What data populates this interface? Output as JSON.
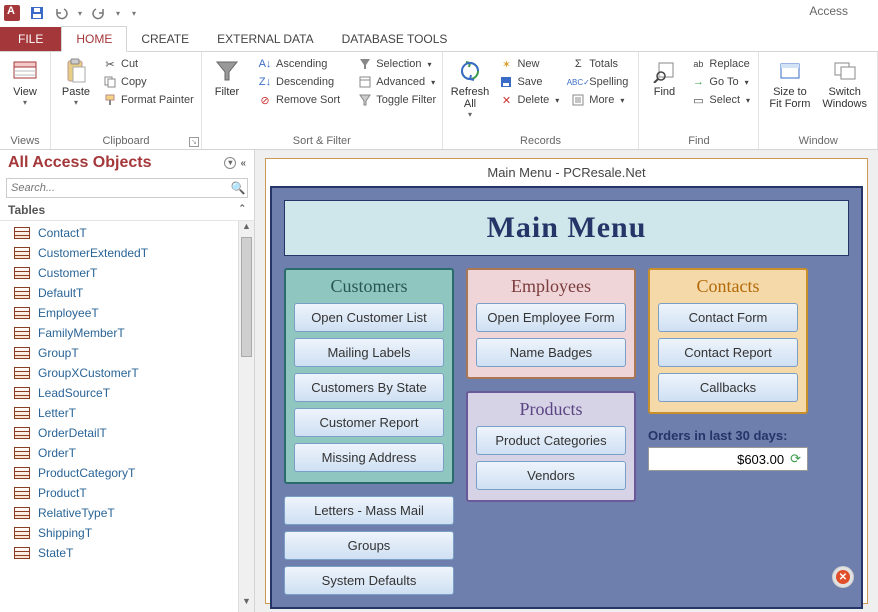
{
  "app": {
    "title": "Access"
  },
  "qat": {
    "save": "save-icon",
    "undo": "undo-icon",
    "redo": "redo-icon"
  },
  "tabs": {
    "file": "FILE",
    "home": "HOME",
    "create": "CREATE",
    "external": "EXTERNAL DATA",
    "dbtools": "DATABASE TOOLS"
  },
  "ribbon": {
    "views": {
      "label": "Views",
      "view": "View"
    },
    "clipboard": {
      "label": "Clipboard",
      "paste": "Paste",
      "cut": "Cut",
      "copy": "Copy",
      "fmt": "Format Painter"
    },
    "sortfilter": {
      "label": "Sort & Filter",
      "filter": "Filter",
      "asc": "Ascending",
      "desc": "Descending",
      "remove": "Remove Sort",
      "selection": "Selection",
      "advanced": "Advanced",
      "toggle": "Toggle Filter"
    },
    "records": {
      "label": "Records",
      "refresh": "Refresh\nAll",
      "new": "New",
      "save": "Save",
      "delete": "Delete",
      "totals": "Totals",
      "spelling": "Spelling",
      "more": "More"
    },
    "find": {
      "label": "Find",
      "find": "Find",
      "replace": "Replace",
      "goto": "Go To",
      "select": "Select"
    },
    "window": {
      "label": "Window",
      "fit": "Size to\nFit Form",
      "switch": "Switch\nWindows"
    }
  },
  "nav": {
    "title": "All Access Objects",
    "search_placeholder": "Search...",
    "tables_header": "Tables",
    "tables": [
      "ContactT",
      "CustomerExtendedT",
      "CustomerT",
      "DefaultT",
      "EmployeeT",
      "FamilyMemberT",
      "GroupT",
      "GroupXCustomerT",
      "LeadSourceT",
      "LetterT",
      "OrderDetailT",
      "OrderT",
      "ProductCategoryT",
      "ProductT",
      "RelativeTypeT",
      "ShippingT",
      "StateT"
    ]
  },
  "form": {
    "caption": "Main Menu - PCResale.Net",
    "title": "Main Menu",
    "customers": {
      "head": "Customers",
      "btns": [
        "Open Customer List",
        "Mailing Labels",
        "Customers By State",
        "Customer Report",
        "Missing Address"
      ]
    },
    "employees": {
      "head": "Employees",
      "btns": [
        "Open Employee Form",
        "Name Badges"
      ]
    },
    "products": {
      "head": "Products",
      "btns": [
        "Product Categories",
        "Vendors"
      ]
    },
    "contacts": {
      "head": "Contacts",
      "btns": [
        "Contact Form",
        "Contact Report",
        "Callbacks"
      ]
    },
    "extras": [
      "Letters - Mass Mail",
      "Groups",
      "System Defaults"
    ],
    "orders": {
      "label": "Orders in last 30 days:",
      "value": "$603.00"
    }
  }
}
